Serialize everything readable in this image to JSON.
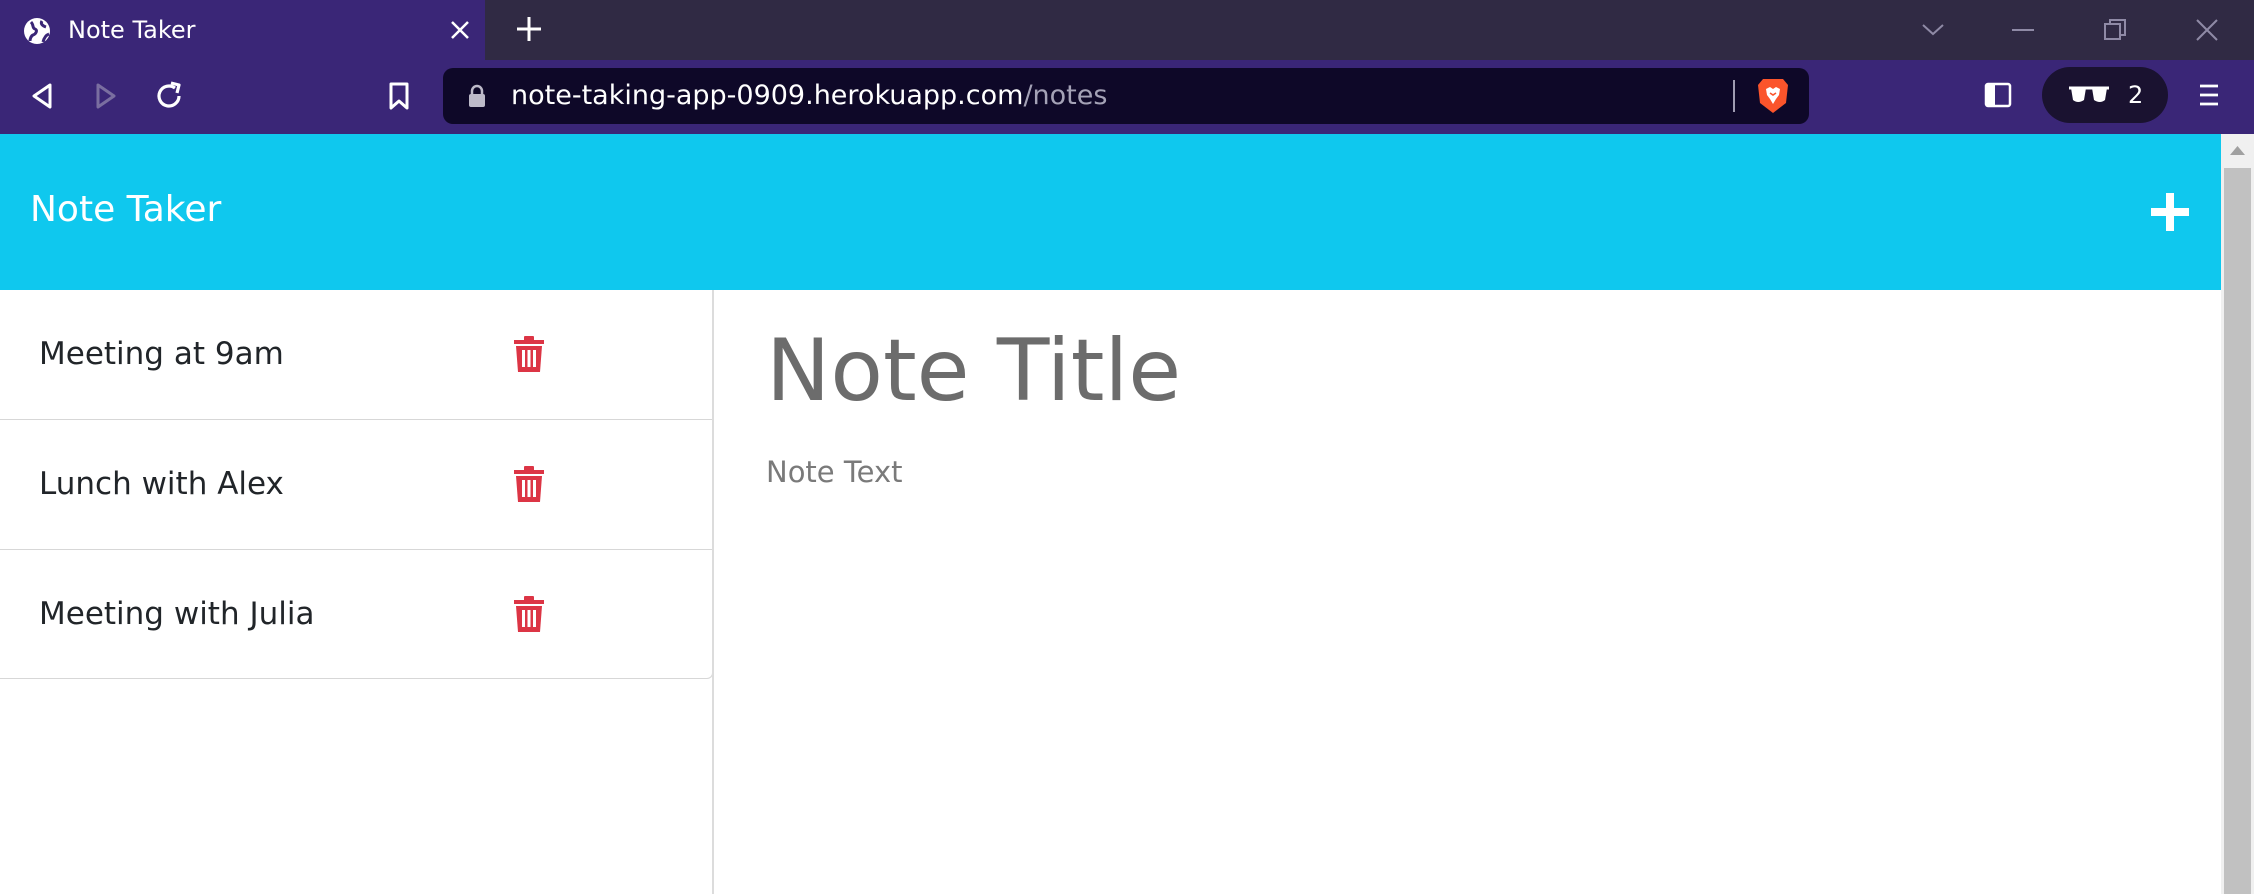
{
  "browser": {
    "tab_title": "Note Taker",
    "url_host": "note-taking-app-0909.herokuapp.com",
    "url_path": "/notes",
    "shields_count": "2"
  },
  "app": {
    "title": "Note Taker",
    "header_color": "#0fc8ee",
    "add_icon": "plus-icon"
  },
  "notes": [
    {
      "title": "Meeting at 9am"
    },
    {
      "title": "Lunch with Alex"
    },
    {
      "title": "Meeting with Julia"
    }
  ],
  "editor": {
    "title_placeholder": "Note Title",
    "text_placeholder": "Note Text"
  },
  "colors": {
    "delete": "#dc3545",
    "tab_active": "#3a2677",
    "chrome_bg": "#302a44"
  }
}
